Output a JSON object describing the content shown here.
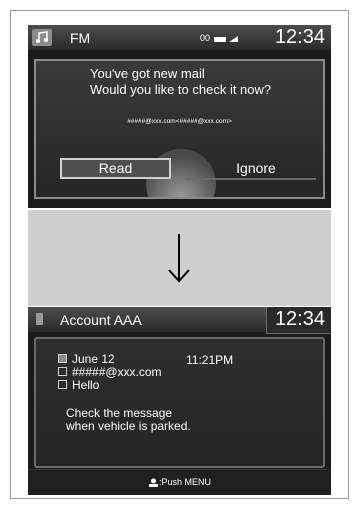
{
  "screen1": {
    "source": "FM",
    "indicators": "00",
    "clock": "12:34",
    "popup": {
      "line1": "You've got new mail",
      "line2": "Would you like to check it now?",
      "address": "#####@xxx.com<#####@xxx.com>",
      "read_label": "Read",
      "ignore_label": "Ignore"
    }
  },
  "screen2": {
    "title": "Account AAA",
    "clock": "12:34",
    "date": "June 12",
    "time": "11:21PM",
    "sender": "#####@xxx.com",
    "subject": "Hello",
    "note_line1": "Check the message",
    "note_line2": "when vehicle is parked.",
    "footer": ":Push MENU"
  },
  "icons": [
    "music-icon",
    "signal-icon",
    "down-arrow-icon",
    "phone-icon",
    "calendar-icon",
    "mail-icon",
    "subject-icon",
    "menu-knob-icon"
  ]
}
